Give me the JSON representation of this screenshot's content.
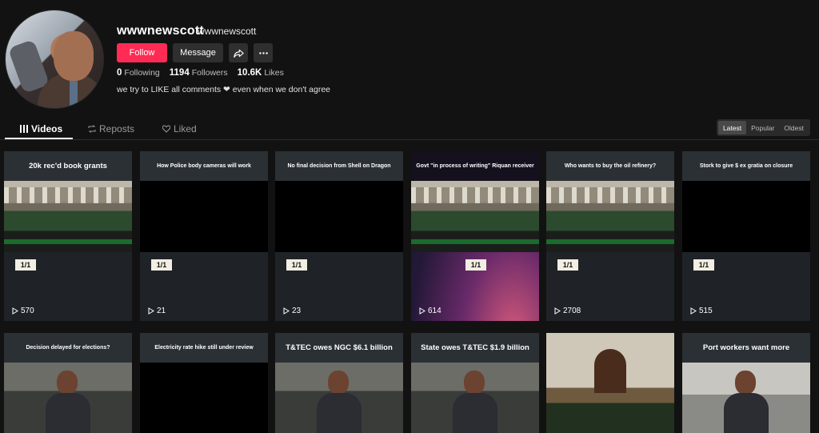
{
  "profile": {
    "username": "wwwnewscott",
    "nickname": "wwwnewscott",
    "follow_label": "Follow",
    "message_label": "Message",
    "following_count": "0",
    "following_label": "Following",
    "followers_count": "1194",
    "followers_label": "Followers",
    "likes_count": "10.6K",
    "likes_label": "Likes",
    "bio": "we try to LIKE all comments ❤ even when we don't agree",
    "accent": "#fe2c55"
  },
  "tabs": [
    {
      "label": "Videos",
      "icon": "grid-icon",
      "active": true
    },
    {
      "label": "Reposts",
      "icon": "repost-icon",
      "active": false
    },
    {
      "label": "Liked",
      "icon": "heart-outline-icon",
      "active": false
    }
  ],
  "sort": [
    "Latest",
    "Popular",
    "Oldest"
  ],
  "videos": [
    {
      "title": "20k rec'd book grants",
      "views": "570",
      "badge": "1/1"
    },
    {
      "title": "How Police body cameras will work",
      "views": "21",
      "badge": "1/1"
    },
    {
      "title": "No final decision from Shell on Dragon",
      "views": "23",
      "badge": "1/1"
    },
    {
      "title": "Govt \"in process of writing\" Riquan receiver",
      "views": "614",
      "badge": "1/1"
    },
    {
      "title": "Who wants to buy the oil refinery?",
      "views": "2708",
      "badge": "1/1"
    },
    {
      "title": "Stork to give $ ex gratia on closure",
      "views": "515",
      "badge": "1/1"
    },
    {
      "title": "Decision delayed for elections?"
    },
    {
      "title": "Electricity rate hike still under review"
    },
    {
      "title": "T&TEC owes NGC $6.1 billion"
    },
    {
      "title": "State owes T&TEC $1.9 billion"
    },
    {
      "title": ""
    },
    {
      "title": "Port workers want more"
    }
  ]
}
